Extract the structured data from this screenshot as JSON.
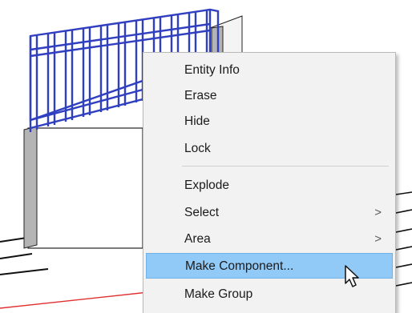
{
  "context_menu": {
    "items": [
      {
        "label": "Entity Info"
      },
      {
        "label": "Erase"
      },
      {
        "label": "Hide"
      },
      {
        "label": "Lock"
      },
      {
        "label": "Explode"
      },
      {
        "label": "Select",
        "submenu_arrow": ">"
      },
      {
        "label": "Area",
        "submenu_arrow": ">"
      },
      {
        "label": "Make Component...",
        "highlighted": true
      },
      {
        "label": "Make Group"
      }
    ]
  },
  "colors": {
    "selection_blue": "#2f3fc0",
    "menu_background": "#f2f2f2",
    "menu_highlight": "#91c9f7",
    "red_axis": "#e03030",
    "model_gray": "#b4b4b4"
  }
}
